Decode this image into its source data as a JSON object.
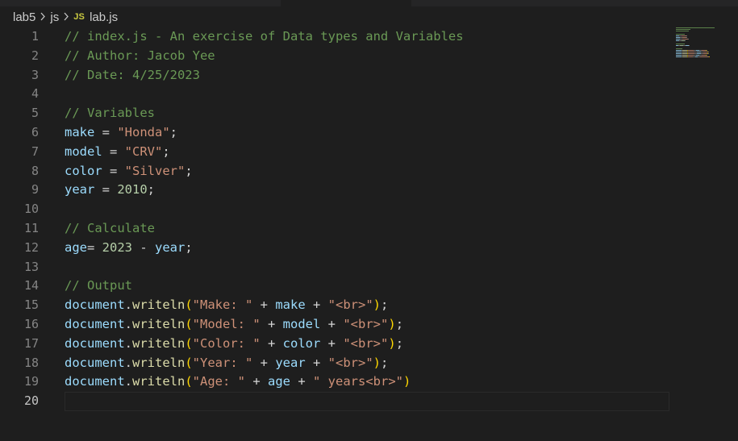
{
  "breadcrumb": {
    "items": [
      {
        "label": "lab5"
      },
      {
        "label": "js"
      },
      {
        "label": "lab.js",
        "icon": "JS"
      }
    ]
  },
  "editor": {
    "active_line": 20,
    "lines": [
      {
        "num": "1",
        "tokens": [
          {
            "t": "comment",
            "v": "// index.js - An exercise of Data types and Variables"
          }
        ]
      },
      {
        "num": "2",
        "tokens": [
          {
            "t": "comment",
            "v": "// Author: Jacob Yee"
          }
        ]
      },
      {
        "num": "3",
        "tokens": [
          {
            "t": "comment",
            "v": "// Date: 4/25/2023"
          }
        ]
      },
      {
        "num": "4",
        "tokens": []
      },
      {
        "num": "5",
        "tokens": [
          {
            "t": "comment",
            "v": "// Variables"
          }
        ]
      },
      {
        "num": "6",
        "tokens": [
          {
            "t": "var",
            "v": "make"
          },
          {
            "t": "op",
            "v": " = "
          },
          {
            "t": "str",
            "v": "\"Honda\""
          },
          {
            "t": "op",
            "v": ";"
          }
        ]
      },
      {
        "num": "7",
        "tokens": [
          {
            "t": "var",
            "v": "model"
          },
          {
            "t": "op",
            "v": " = "
          },
          {
            "t": "str",
            "v": "\"CRV\""
          },
          {
            "t": "op",
            "v": ";"
          }
        ]
      },
      {
        "num": "8",
        "tokens": [
          {
            "t": "var",
            "v": "color"
          },
          {
            "t": "op",
            "v": " = "
          },
          {
            "t": "str",
            "v": "\"Silver\""
          },
          {
            "t": "op",
            "v": ";"
          }
        ]
      },
      {
        "num": "9",
        "tokens": [
          {
            "t": "var",
            "v": "year"
          },
          {
            "t": "op",
            "v": " = "
          },
          {
            "t": "num",
            "v": "2010"
          },
          {
            "t": "op",
            "v": ";"
          }
        ]
      },
      {
        "num": "10",
        "tokens": []
      },
      {
        "num": "11",
        "tokens": [
          {
            "t": "comment",
            "v": "// Calculate"
          }
        ]
      },
      {
        "num": "12",
        "tokens": [
          {
            "t": "var",
            "v": "age"
          },
          {
            "t": "op",
            "v": "= "
          },
          {
            "t": "num",
            "v": "2023"
          },
          {
            "t": "op",
            "v": " - "
          },
          {
            "t": "var",
            "v": "year"
          },
          {
            "t": "op",
            "v": ";"
          }
        ]
      },
      {
        "num": "13",
        "tokens": []
      },
      {
        "num": "14",
        "tokens": [
          {
            "t": "comment",
            "v": "// Output"
          }
        ]
      },
      {
        "num": "15",
        "tokens": [
          {
            "t": "var",
            "v": "document"
          },
          {
            "t": "op",
            "v": "."
          },
          {
            "t": "fn",
            "v": "writeln"
          },
          {
            "t": "paren",
            "v": "("
          },
          {
            "t": "str",
            "v": "\"Make: \""
          },
          {
            "t": "op",
            "v": " + "
          },
          {
            "t": "var",
            "v": "make"
          },
          {
            "t": "op",
            "v": " + "
          },
          {
            "t": "str",
            "v": "\"<br>\""
          },
          {
            "t": "paren",
            "v": ")"
          },
          {
            "t": "op",
            "v": ";"
          }
        ]
      },
      {
        "num": "16",
        "tokens": [
          {
            "t": "var",
            "v": "document"
          },
          {
            "t": "op",
            "v": "."
          },
          {
            "t": "fn",
            "v": "writeln"
          },
          {
            "t": "paren",
            "v": "("
          },
          {
            "t": "str",
            "v": "\"Model: \""
          },
          {
            "t": "op",
            "v": " + "
          },
          {
            "t": "var",
            "v": "model"
          },
          {
            "t": "op",
            "v": " + "
          },
          {
            "t": "str",
            "v": "\"<br>\""
          },
          {
            "t": "paren",
            "v": ")"
          },
          {
            "t": "op",
            "v": ";"
          }
        ]
      },
      {
        "num": "17",
        "tokens": [
          {
            "t": "var",
            "v": "document"
          },
          {
            "t": "op",
            "v": "."
          },
          {
            "t": "fn",
            "v": "writeln"
          },
          {
            "t": "paren",
            "v": "("
          },
          {
            "t": "str",
            "v": "\"Color: \""
          },
          {
            "t": "op",
            "v": " + "
          },
          {
            "t": "var",
            "v": "color"
          },
          {
            "t": "op",
            "v": " + "
          },
          {
            "t": "str",
            "v": "\"<br>\""
          },
          {
            "t": "paren",
            "v": ")"
          },
          {
            "t": "op",
            "v": ";"
          }
        ]
      },
      {
        "num": "18",
        "tokens": [
          {
            "t": "var",
            "v": "document"
          },
          {
            "t": "op",
            "v": "."
          },
          {
            "t": "fn",
            "v": "writeln"
          },
          {
            "t": "paren",
            "v": "("
          },
          {
            "t": "str",
            "v": "\"Year: \""
          },
          {
            "t": "op",
            "v": " + "
          },
          {
            "t": "var",
            "v": "year"
          },
          {
            "t": "op",
            "v": " + "
          },
          {
            "t": "str",
            "v": "\"<br>\""
          },
          {
            "t": "paren",
            "v": ")"
          },
          {
            "t": "op",
            "v": ";"
          }
        ]
      },
      {
        "num": "19",
        "tokens": [
          {
            "t": "var",
            "v": "document"
          },
          {
            "t": "op",
            "v": "."
          },
          {
            "t": "fn",
            "v": "writeln"
          },
          {
            "t": "paren",
            "v": "("
          },
          {
            "t": "str",
            "v": "\"Age: \""
          },
          {
            "t": "op",
            "v": " + "
          },
          {
            "t": "var",
            "v": "age"
          },
          {
            "t": "op",
            "v": " + "
          },
          {
            "t": "str",
            "v": "\" years<br>\""
          },
          {
            "t": "paren",
            "v": ")"
          }
        ]
      },
      {
        "num": "20",
        "tokens": []
      }
    ]
  },
  "colors": {
    "background": "#1e1e1e",
    "comment": "#6a9955",
    "variable": "#9cdcfe",
    "string": "#ce9178",
    "number": "#b5cea8",
    "function": "#dcdcaa",
    "bracket": "#ffd700",
    "line_number": "#858585",
    "line_number_active": "#c6c6c6"
  }
}
